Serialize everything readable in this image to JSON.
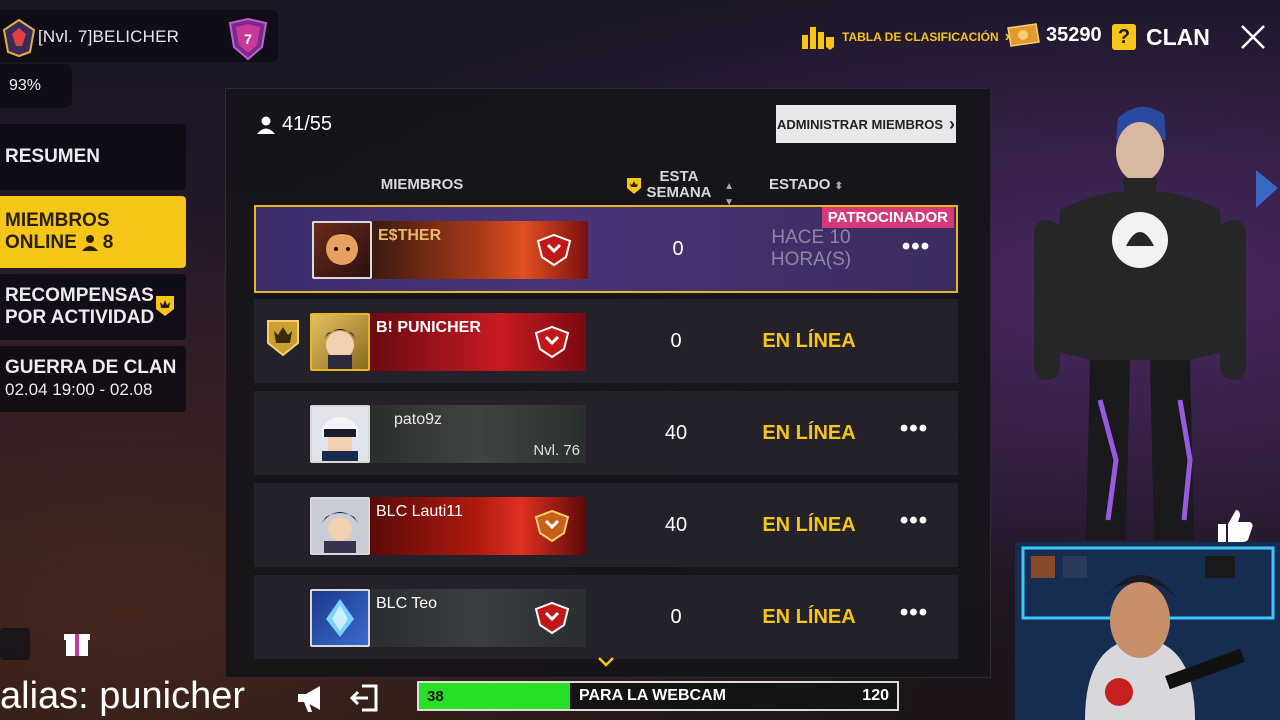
{
  "player": {
    "name": "[Nvl. 7]BELICHER",
    "rank_level": "7"
  },
  "battery": "93%",
  "header": {
    "ranking_label": "TABLA DE CLASIFICACIÓN",
    "coins": "35290",
    "help_glyph": "?",
    "clan_label": "CLAN"
  },
  "sidebar": {
    "items": [
      {
        "label": "RESUMEN"
      },
      {
        "label": "MIEMBROS",
        "label2": "ONLINE",
        "count": "8"
      },
      {
        "label": "RECOMPENSAS",
        "label2": "POR ACTIVIDAD"
      },
      {
        "label": "GUERRA DE CLAN",
        "label2": "02.04 19:00 - 02.08"
      }
    ]
  },
  "panel": {
    "member_count": "41/55",
    "admin_button": "ADMINISTRAR MIEMBROS",
    "columns": {
      "members": "MIEMBROS",
      "week_line1": "ESTA",
      "week_line2": "SEMANA",
      "status": "ESTADO"
    },
    "rows": [
      {
        "name": "E$THER",
        "week": "0",
        "status_line1": "HACE 10",
        "status_line2": "HORA(S)",
        "tag": "PATROCINADOR"
      },
      {
        "name": "B!   PUNICHER",
        "week": "0",
        "status": "EN LÍNEA"
      },
      {
        "name": "pato9z",
        "level": "Nvl. 76",
        "week": "40",
        "status": "EN LÍNEA"
      },
      {
        "name": "BLC   Lauti11",
        "week": "40",
        "status": "EN LÍNEA"
      },
      {
        "name": "BLC   Teo",
        "week": "0",
        "status": "EN LÍNEA"
      }
    ]
  },
  "overlay": {
    "alias": "alias: punicher",
    "goal": {
      "current": "38",
      "label": "PARA LA WEBCAM",
      "target": "120",
      "progress": 0.3167
    }
  },
  "colors": {
    "accent": "#f5c518",
    "sponsor": "#d43a7a",
    "online": "#f5c518",
    "goal": "#25e025"
  }
}
